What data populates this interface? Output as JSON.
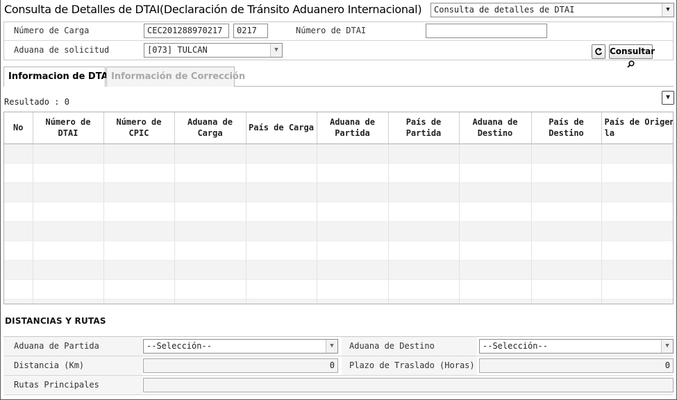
{
  "header": {
    "title": "Consulta de Detalles de DTAI(Declaración de Tránsito Aduanero Internacional)",
    "screen_select": "Consulta de detalles de DTAI"
  },
  "search": {
    "carga_label": "Número de Carga",
    "carga_value": "CEC201288970217",
    "carga_suffix": "0217",
    "dtai_label": "Número de DTAI",
    "dtai_value": "",
    "aduana_label": "Aduana de solicitud",
    "aduana_value": "[073] TULCAN",
    "refresh_icon": "refresh-icon",
    "consultar_label": "Consultar",
    "consultar_icon": "magnifier-icon"
  },
  "tabs": [
    {
      "label": "Informacion de DTAI",
      "active": true
    },
    {
      "label": "Información de Corrección",
      "active": false
    }
  ],
  "result": {
    "text": "Resultado : 0"
  },
  "grid": {
    "columns": [
      "No",
      "Número de DTAI",
      "Número de CPIC",
      "Aduana de Carga",
      "País de Carga",
      "Aduana de Partida",
      "País de Partida",
      "Aduana de Destino",
      "País de Destino",
      "País de Origen de la"
    ],
    "rows": []
  },
  "distancias": {
    "section_title": "DISTANCIAS Y RUTAS",
    "partida_label": "Aduana de Partida",
    "partida_value": "--Selección--",
    "destino_label": "Aduana de Destino",
    "destino_value": "--Selección--",
    "distancia_label": "Distancia (Km)",
    "distancia_value": "0",
    "plazo_label": "Plazo de Traslado (Horas)",
    "plazo_value": "0",
    "rutas_label": "Rutas Principales",
    "rutas_value": ""
  },
  "colors": {
    "border": "#8a8a8a",
    "label_bg": "#f5f5f5",
    "row_alt": "#f3f3f3",
    "inactive_tab_text": "#a8a8a8"
  }
}
